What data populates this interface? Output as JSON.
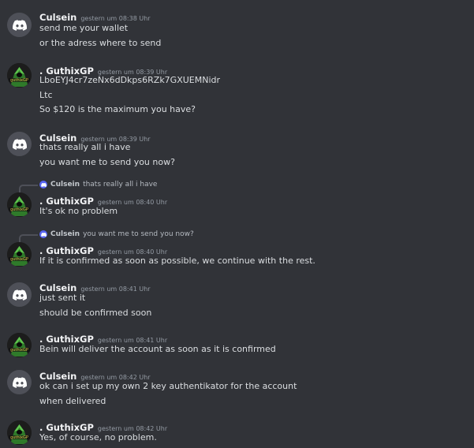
{
  "users": {
    "culsein": {
      "name": "Culsein"
    },
    "guthix": {
      "name": ". GuthixGP",
      "avatar_text": "guthixGP"
    }
  },
  "messages": [
    {
      "author": "Culsein",
      "timestamp": "gestern um 08:38 Uhr",
      "lines": [
        "send me your wallet",
        "or the adress where to send"
      ]
    },
    {
      "author": ". GuthixGP",
      "timestamp": "gestern um 08:39 Uhr",
      "lines": [
        "LboEYJ4cr7zeNx6dDkps6RZk7GXUEMNidr",
        "Ltc",
        "So $120 is the maximum you have?"
      ]
    },
    {
      "author": "Culsein",
      "timestamp": "gestern um 08:39 Uhr",
      "lines": [
        "thats really all i have",
        "you want me to send you now?"
      ]
    },
    {
      "reply_author": "Culsein",
      "reply_text": "thats really all i have",
      "author": ". GuthixGP",
      "timestamp": "gestern um 08:40 Uhr",
      "lines": [
        "It's ok no problem"
      ]
    },
    {
      "reply_author": "Culsein",
      "reply_text": "you want me to send you now?",
      "author": ". GuthixGP",
      "timestamp": "gestern um 08:40 Uhr",
      "lines": [
        "If it is confirmed as soon as possible, we continue with the rest."
      ]
    },
    {
      "author": "Culsein",
      "timestamp": "gestern um 08:41 Uhr",
      "lines": [
        "just sent it",
        "should be confirmed soon"
      ]
    },
    {
      "author": ". GuthixGP",
      "timestamp": "gestern um 08:41 Uhr",
      "lines": [
        "Bein will deliver the account as soon as it is confirmed"
      ]
    },
    {
      "author": "Culsein",
      "timestamp": "gestern um 08:42 Uhr",
      "lines": [
        "ok can i set up my own 2 key authentikator for the account",
        "when delivered"
      ]
    },
    {
      "author": ". GuthixGP",
      "timestamp": "gestern um 08:42 Uhr",
      "lines": [
        "Yes, of course, no problem."
      ]
    }
  ]
}
